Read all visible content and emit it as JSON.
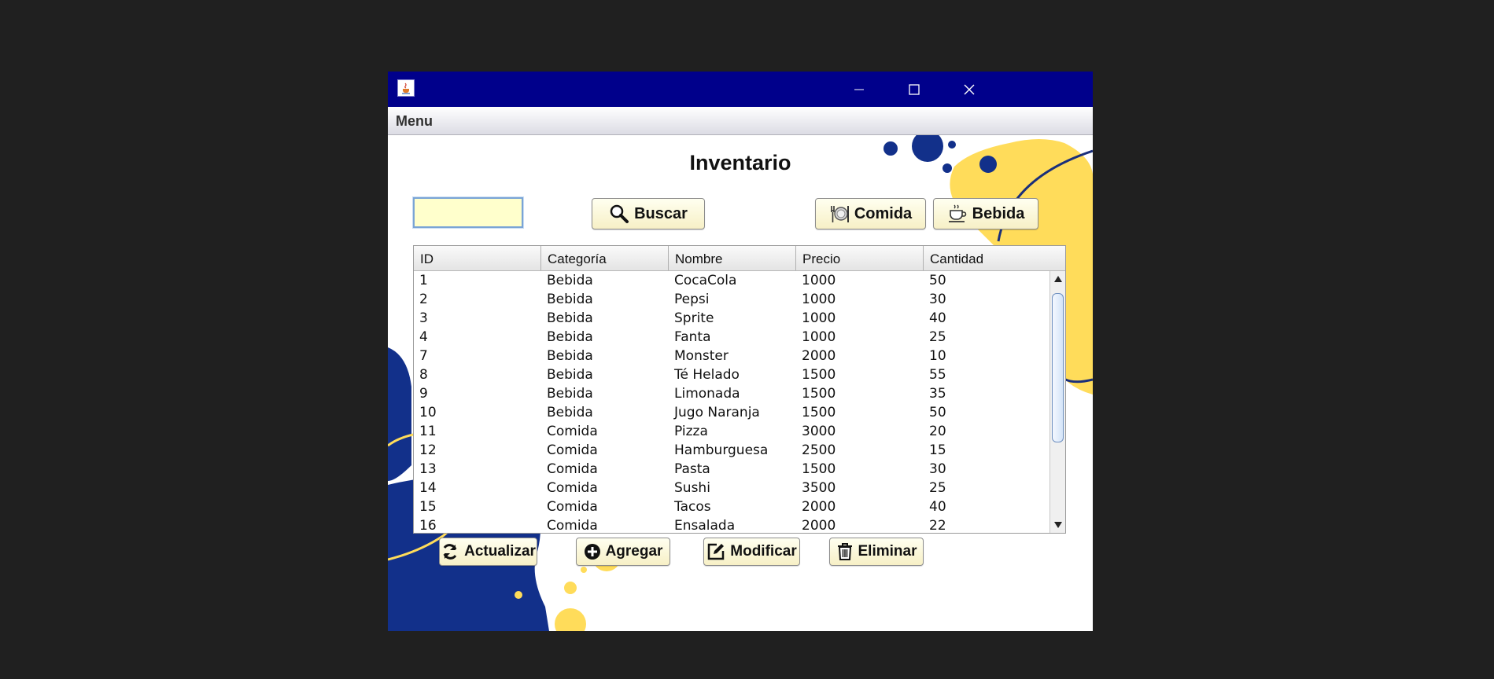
{
  "window": {
    "menu": "Menu",
    "controls": [
      "minimize-icon",
      "maximize-icon",
      "close-icon"
    ]
  },
  "page": {
    "title": "Inventario"
  },
  "search": {
    "value": "",
    "button_label": "Buscar"
  },
  "filters": {
    "comida_label": "Comida",
    "bebida_label": "Bebida"
  },
  "table": {
    "columns": [
      "ID",
      "Categoría",
      "Nombre",
      "Precio",
      "Cantidad"
    ],
    "rows": [
      [
        "1",
        "Bebida",
        "CocaCola",
        "1000",
        "50"
      ],
      [
        "2",
        "Bebida",
        "Pepsi",
        "1000",
        "30"
      ],
      [
        "3",
        "Bebida",
        "Sprite",
        "1000",
        "40"
      ],
      [
        "4",
        "Bebida",
        "Fanta",
        "1000",
        "25"
      ],
      [
        "7",
        "Bebida",
        "Monster",
        "2000",
        "10"
      ],
      [
        "8",
        "Bebida",
        "Té Helado",
        "1500",
        "55"
      ],
      [
        "9",
        "Bebida",
        "Limonada",
        "1500",
        "35"
      ],
      [
        "10",
        "Bebida",
        "Jugo Naranja",
        "1500",
        "50"
      ],
      [
        "11",
        "Comida",
        "Pizza",
        "3000",
        "20"
      ],
      [
        "12",
        "Comida",
        "Hamburguesa",
        "2500",
        "15"
      ],
      [
        "13",
        "Comida",
        "Pasta",
        "1500",
        "30"
      ],
      [
        "14",
        "Comida",
        "Sushi",
        "3500",
        "25"
      ],
      [
        "15",
        "Comida",
        "Tacos",
        "2000",
        "40"
      ],
      [
        "16",
        "Comida",
        "Ensalada",
        "2000",
        "22"
      ]
    ]
  },
  "actions": {
    "actualizar": "Actualizar",
    "agregar": "Agregar",
    "modificar": "Modificar",
    "eliminar": "Eliminar"
  },
  "colors": {
    "titlebar": "#00008b",
    "navy_decoration": "#12308a",
    "yellow_decoration": "#ffdc5a",
    "button_fill": "#fff8d6",
    "search_fill": "#ffffcc"
  }
}
